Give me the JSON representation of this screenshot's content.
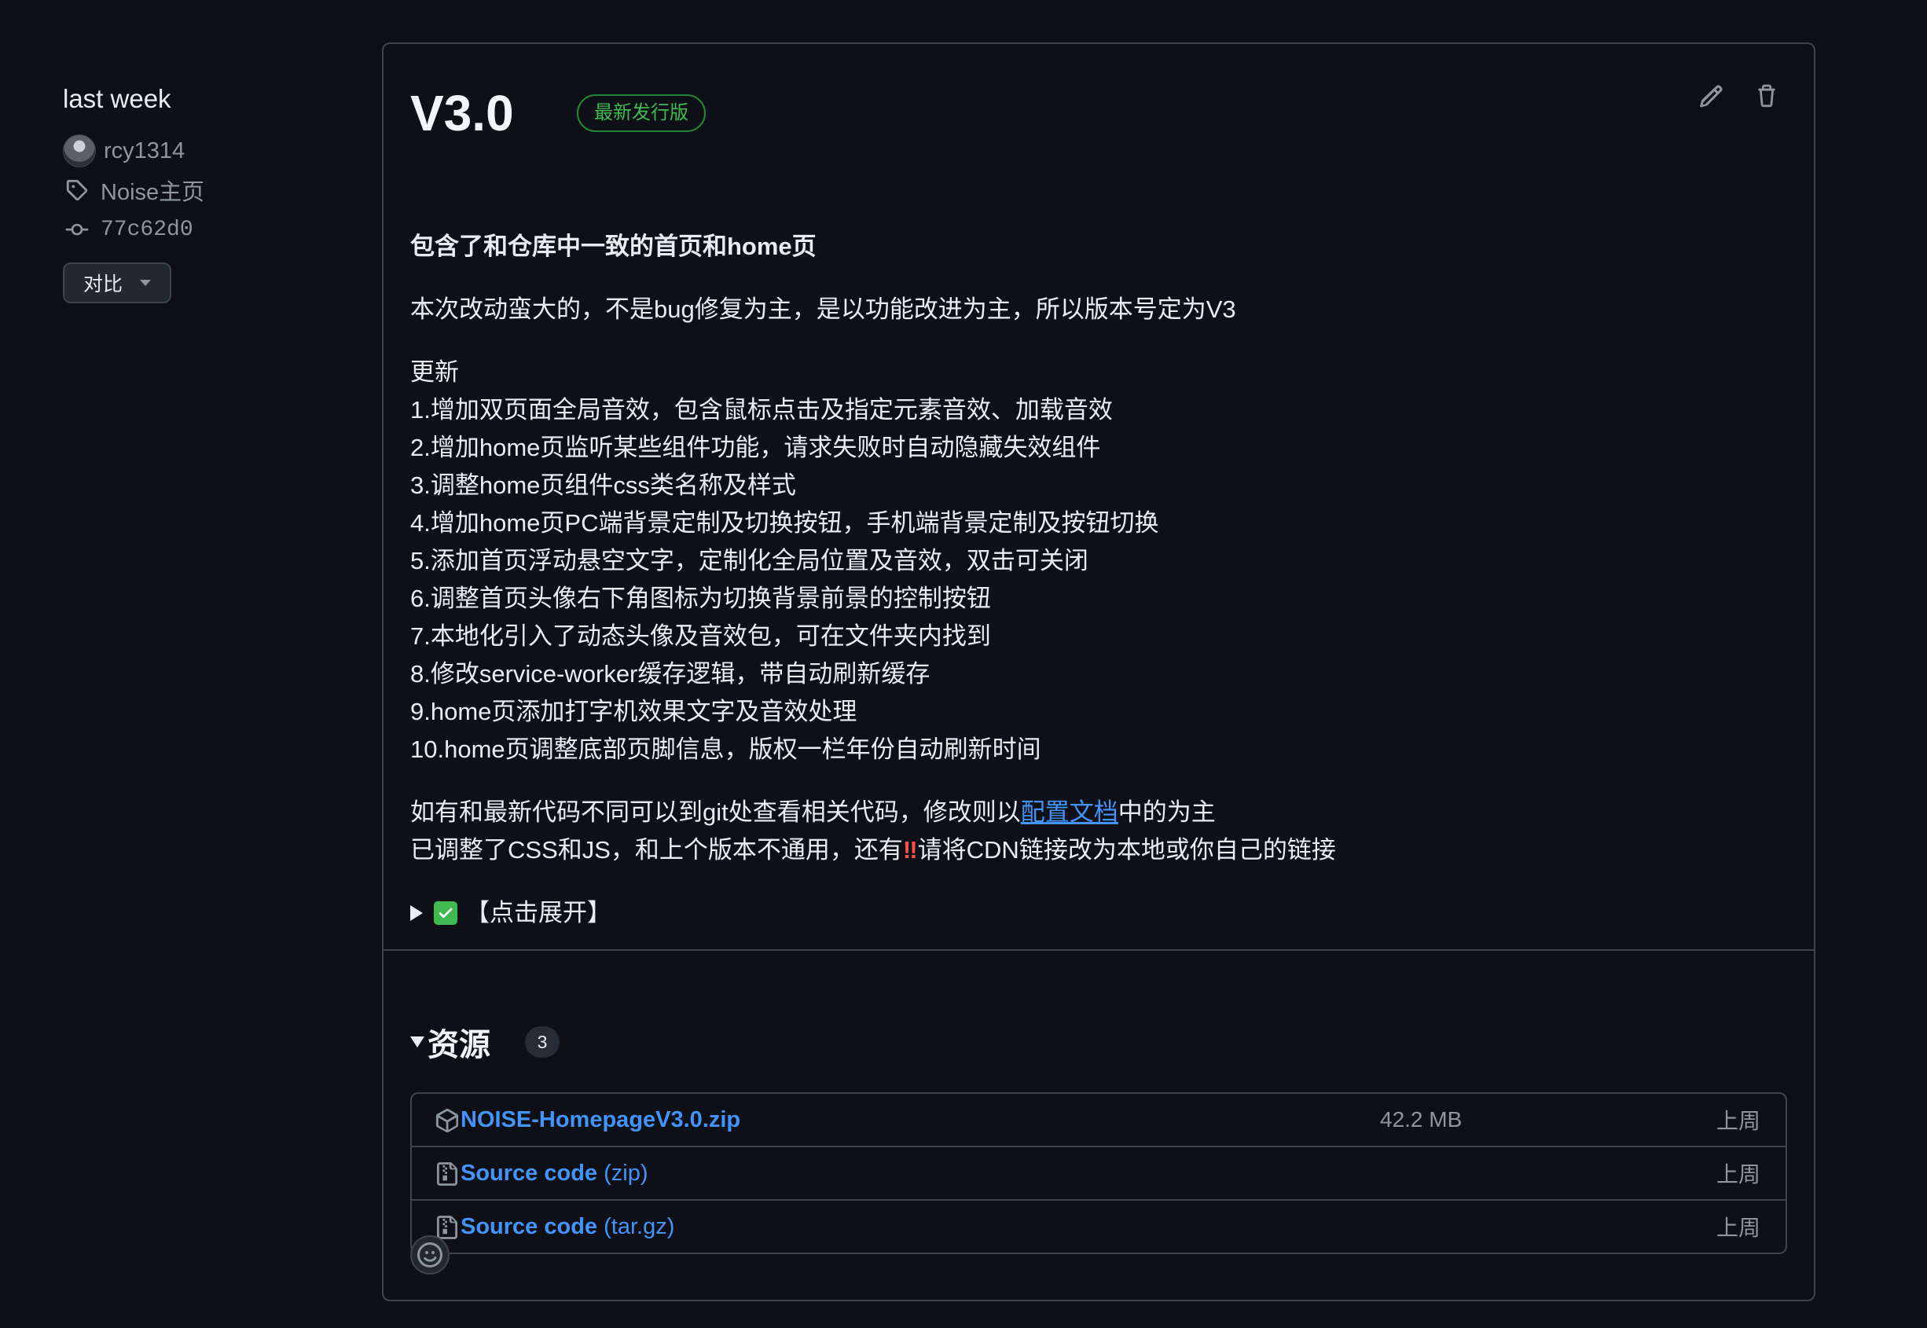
{
  "sidebar": {
    "date": "last week",
    "author": "rcy1314",
    "tag": "Noise主页",
    "commit": "77c62d0",
    "compare_label": "对比"
  },
  "release": {
    "title": "V3.0",
    "badge": "最新发行版",
    "notes": {
      "heading": "包含了和仓库中一致的首页和home页",
      "intro": "本次改动蛮大的，不是bug修复为主，是以功能改进为主，所以版本号定为V3",
      "update_label": "更新",
      "items": [
        "1.增加双页面全局音效，包含鼠标点击及指定元素音效、加载音效",
        "2.增加home页监听某些组件功能，请求失败时自动隐藏失效组件",
        "3.调整home页组件css类名称及样式",
        "4.增加home页PC端背景定制及切换按钮，手机端背景定制及按钮切换",
        "5.添加首页浮动悬空文字，定制化全局位置及音效，双击可关闭",
        "6.调整首页头像右下角图标为切换背景前景的控制按钮",
        "7.本地化引入了动态头像及音效包，可在文件夹内找到",
        "8.修改service-worker缓存逻辑，带自动刷新缓存",
        "9.home页添加打字机效果文字及音效处理",
        "10.home页调整底部页脚信息，版权一栏年份自动刷新时间"
      ],
      "note1_before": "如有和最新代码不同可以到git处查看相关代码，修改则以",
      "note1_link": "配置文档",
      "note1_after": "中的为主",
      "note2_before": "已调整了CSS和JS，和上个版本不通用，还有",
      "note2_bang": "‼",
      "note2_after": "请将CDN链接改为本地或你自己的链接",
      "details_label": "【点击展开】"
    }
  },
  "assets": {
    "title": "资源",
    "count": "3",
    "items": [
      {
        "name": "NOISE-HomepageV3.0.zip",
        "suffix": "",
        "size": "42.2 MB",
        "date": "上周",
        "icon": "package-icon"
      },
      {
        "name": "Source code",
        "suffix": " (zip)",
        "size": "",
        "date": "上周",
        "icon": "file-zip-icon"
      },
      {
        "name": "Source code",
        "suffix": " (tar.gz)",
        "size": "",
        "date": "上周",
        "icon": "file-zip-icon"
      }
    ]
  },
  "colors": {
    "background": "#0d1117",
    "border": "#3d444d",
    "link": "#4493f8",
    "badge_green": "#3fb950",
    "muted": "#8d96a0"
  }
}
